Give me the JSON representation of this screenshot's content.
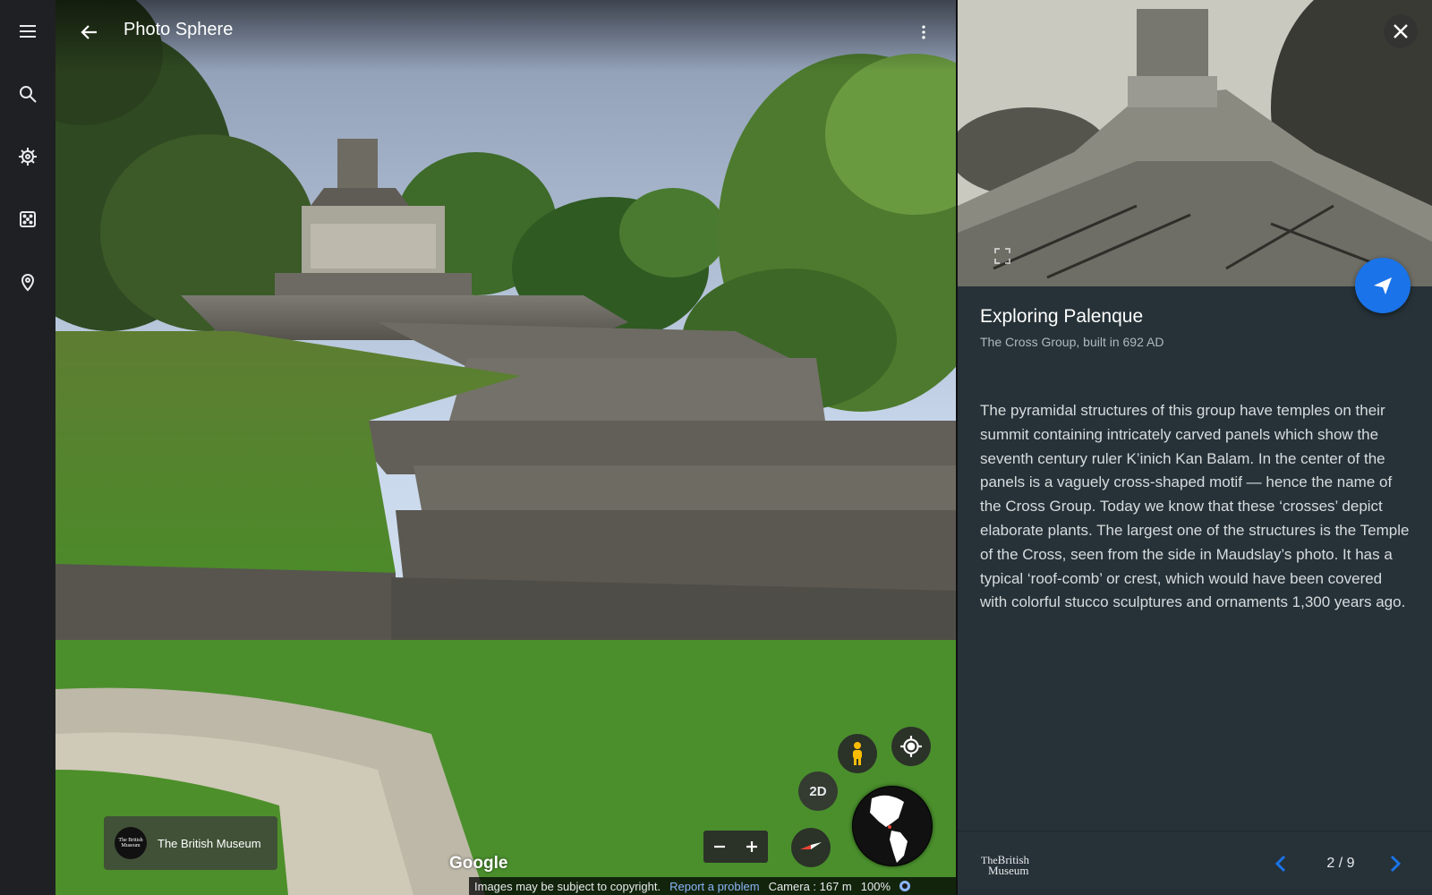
{
  "rail": {
    "items": [
      {
        "name": "menu-icon"
      },
      {
        "name": "search-icon"
      },
      {
        "name": "voyager-icon"
      },
      {
        "name": "feeling-lucky-icon"
      },
      {
        "name": "projects-icon"
      }
    ]
  },
  "viewer": {
    "title": "Photo Sphere",
    "attribution": {
      "logo_text": "The British Museum",
      "name": "The British Museum"
    },
    "google_logo": "Google",
    "controls": {
      "two_d_label": "2D"
    },
    "status": {
      "copyright": "Images may be subject to copyright.",
      "report": "Report a problem",
      "camera": "Camera :  167 m",
      "zoom": "100%"
    }
  },
  "panel": {
    "title": "Exploring Palenque",
    "subtitle": "The Cross Group, built in 692 AD",
    "body": "The pyramidal structures of this group have temples on their summit containing intricately carved panels which show the seventh century ruler K’inich Kan Balam. In the center of the panels is a vaguely cross-shaped motif — hence the name of the Cross Group. Today we know that these ‘crosses’ depict elaborate plants. The largest one of the structures is the Temple of the Cross, seen from the side in Maudslay’s photo. It has a typical ‘roof-comb’ or crest, which would have been covered with colorful stucco sculptures and ornaments 1,300 years ago.",
    "footer": {
      "logo_line1": "The",
      "logo_line2": "British",
      "logo_line3": "Museum",
      "page": "2 / 9"
    }
  },
  "colors": {
    "accent": "#1a73e8",
    "panel_bg": "#263238",
    "rail_bg": "#1f2023"
  }
}
